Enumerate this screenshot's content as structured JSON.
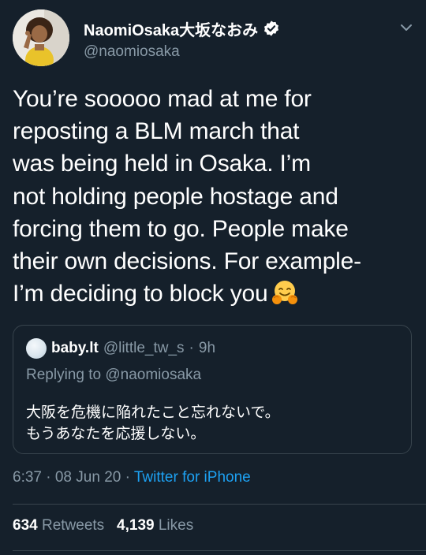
{
  "tweet": {
    "author": {
      "display_name": "NaomiOsaka大坂なおみ",
      "handle": "@naomiosaka",
      "verified": true,
      "avatar_icon": "user-avatar-photo"
    },
    "text": "You’re sooooo mad at me for\nreposting a BLM march that\nwas being held in Osaka. I’m\nnot holding people hostage and\nforcing them to go. People make\ntheir own decisions. For example-\nI’m deciding to block you",
    "emoji": "hugging-face-emoji",
    "quoted": {
      "display_name": "baby.lt",
      "handle": "@little_tw_s",
      "separator": "·",
      "time": "9h",
      "replying_to": "Replying to @naomiosaka",
      "text": "大阪を危機に陥れたこと忘れないで。\nもうあなたを応援しない。"
    },
    "timestamp": "6:37 · 08 Jun 20 · ",
    "source": "Twitter for iPhone",
    "retweets_count": "634",
    "retweets_label": "Retweets",
    "likes_count": "4,139",
    "likes_label": "Likes"
  },
  "colors": {
    "background": "#15202b",
    "text": "#ffffff",
    "muted": "#8899a6",
    "accent": "#1da1f2",
    "border": "#38444d"
  }
}
